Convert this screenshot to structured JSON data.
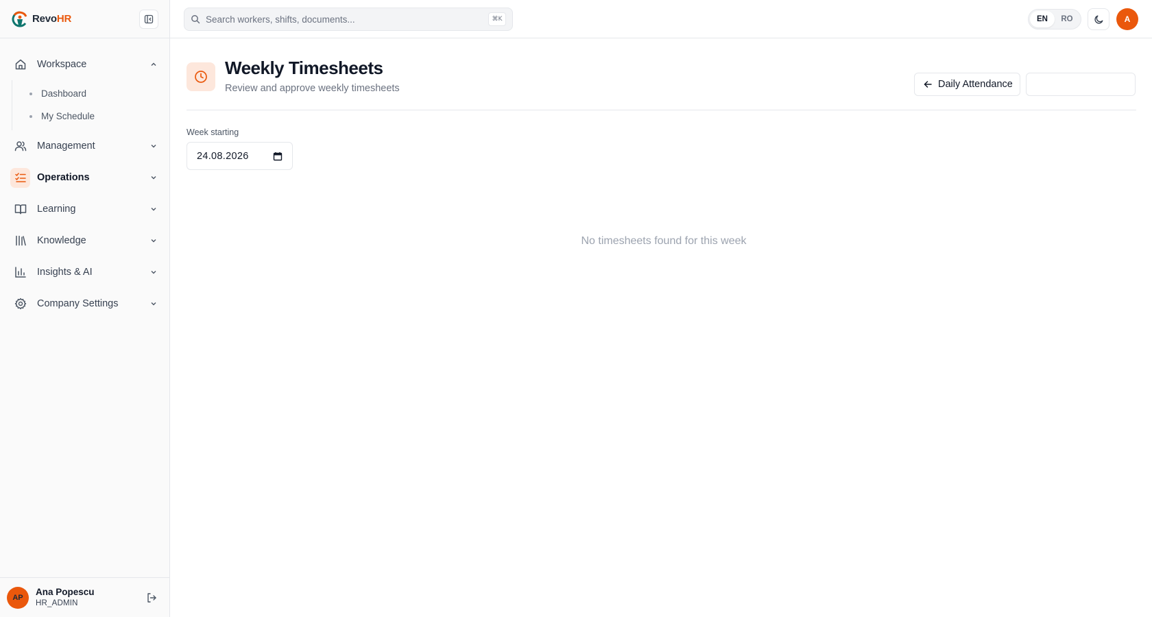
{
  "brand": {
    "name_a": "Revo",
    "name_b": "HR"
  },
  "sidebar": {
    "groups": [
      {
        "label": "Workspace",
        "expanded": true,
        "children": [
          "Dashboard",
          "My Schedule"
        ]
      },
      {
        "label": "Management"
      },
      {
        "label": "Operations",
        "active": true
      },
      {
        "label": "Learning"
      },
      {
        "label": "Knowledge"
      },
      {
        "label": "Insights & AI"
      },
      {
        "label": "Company Settings"
      }
    ],
    "user": {
      "initials": "AP",
      "name": "Ana Popescu",
      "role": "HR_ADMIN"
    }
  },
  "topbar": {
    "search_placeholder": "Search workers, shifts, documents...",
    "shortcut": "⌘K",
    "languages": [
      "EN",
      "RO"
    ],
    "active_language": "EN",
    "avatar_initial": "A"
  },
  "page": {
    "title": "Weekly Timesheets",
    "subtitle": "Review and approve weekly timesheets",
    "daily_button": "Daily Attendance",
    "week_label": "Week starting",
    "week_value": "24.08.2026",
    "empty_message": "No timesheets found for this week"
  },
  "colors": {
    "accent": "#ea580c",
    "accent_soft": "#fde7dc"
  }
}
